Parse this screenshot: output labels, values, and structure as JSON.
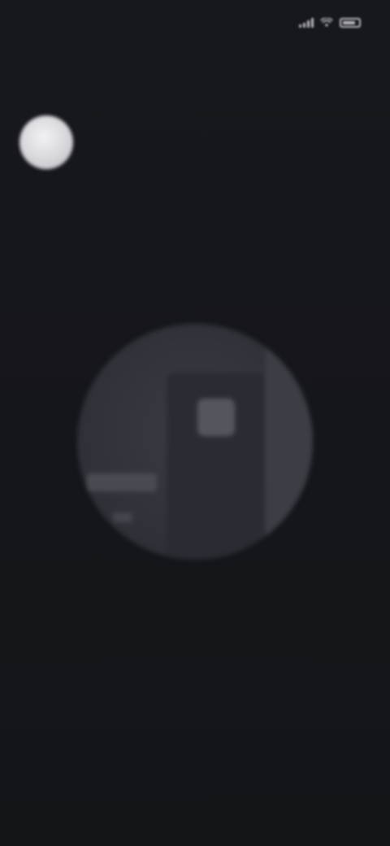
{
  "status_bar": {
    "time": "",
    "network_text": "",
    "icons": [
      "signal-icon",
      "wifi-icon",
      "battery-icon"
    ],
    "time_color": "#c7a15c"
  },
  "header": {
    "title": ""
  },
  "account": {
    "name": ""
  },
  "empty_state": {
    "illustration": "devices-illustration",
    "title": "",
    "description": ""
  },
  "colors": {
    "background": "#15161b",
    "accent": "#c7a15c"
  }
}
